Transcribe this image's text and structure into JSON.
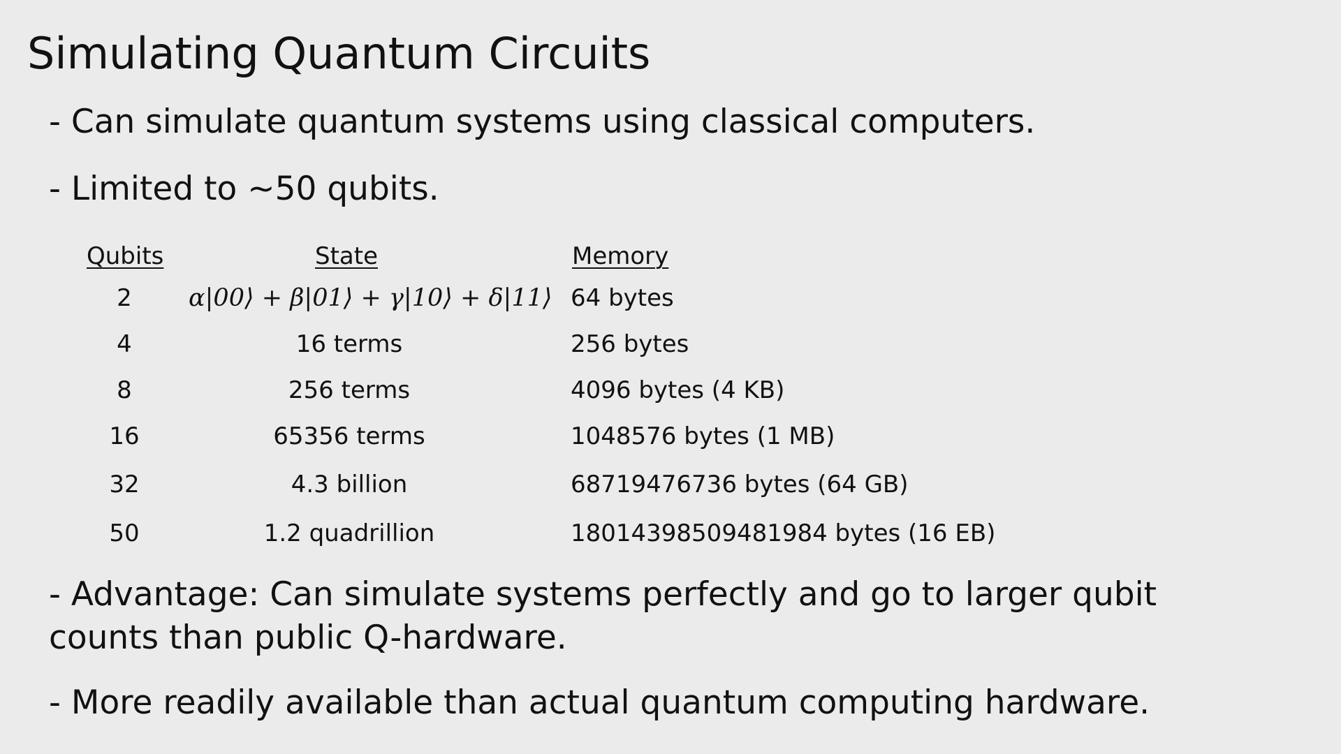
{
  "slide": {
    "title": "Simulating Quantum Circuits",
    "bullets": [
      "- Can simulate quantum systems using classical computers.",
      "- Limited to ~50 qubits.",
      "- Advantage: Can simulate systems perfectly and go to larger qubit counts than public Q-hardware.",
      "- More readily available than actual quantum computing hardware."
    ],
    "table": {
      "headers": [
        "Qubits",
        "State",
        "Memory"
      ],
      "rows": [
        {
          "qubits": "2",
          "state": "α|00⟩ + β|01⟩ + γ|10⟩ + δ|11⟩",
          "memory": "64 bytes"
        },
        {
          "qubits": "4",
          "state": "16 terms",
          "memory": "256 bytes"
        },
        {
          "qubits": "8",
          "state": "256 terms",
          "memory": "4096 bytes (4 KB)"
        },
        {
          "qubits": "16",
          "state": "65356 terms",
          "memory": "1048576 bytes (1 MB)"
        },
        {
          "qubits": "32",
          "state": "4.3 billion",
          "memory": "68719476736 bytes (64 GB)"
        },
        {
          "qubits": "50",
          "state": "1.2 quadrillion",
          "memory": "18014398509481984 bytes (16 EB)"
        }
      ]
    },
    "colors": {
      "background": "#ebebeb",
      "text": "#111111"
    }
  }
}
